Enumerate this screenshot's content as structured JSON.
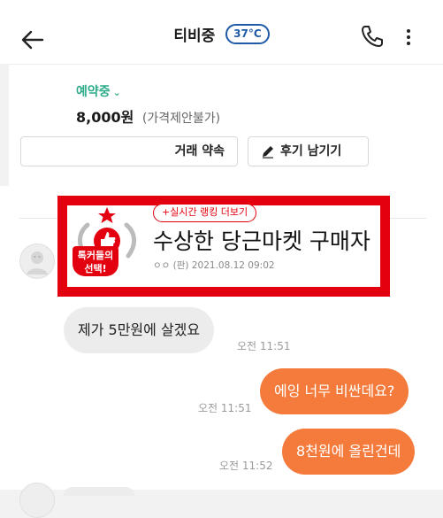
{
  "header": {
    "title": "티비중",
    "temperature": "37°C",
    "icons": [
      "back-arrow-icon",
      "phone-icon",
      "more-vertical-icon"
    ]
  },
  "product": {
    "status": "예약중",
    "price": "8,000원",
    "price_note": "(가격제안불가)",
    "deal_button": "거래 약속",
    "review_button": "후기 남기기"
  },
  "banner": {
    "rank_link": "+실시간 랭킹 더보기",
    "badge_text_line1": "톡커들의",
    "badge_text_line2": "선택!",
    "title": "수상한 당근마켓 구매자",
    "meta": "ㅇㅇ (판) 2021.08.12 09:02",
    "accent_color": "#e3000f"
  },
  "messages": [
    {
      "side": "left",
      "text": "제가 5만원에 살겠요",
      "time": "오전 11:51"
    },
    {
      "side": "right",
      "text": "에잉 너무 비싼데요?",
      "time": "오전 11:51"
    },
    {
      "side": "right",
      "text": "8천원에 올린건데",
      "time": "오전 11:52"
    }
  ],
  "colors": {
    "status_green": "#2dab8a",
    "my_bubble": "#f47b3b",
    "their_bubble": "#ececec",
    "temperature_blue": "#1f5aa6"
  }
}
